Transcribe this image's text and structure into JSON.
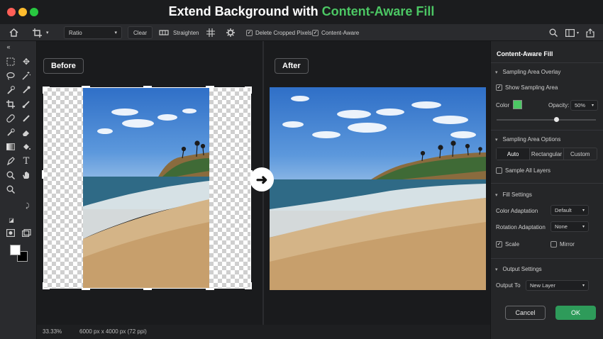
{
  "title": {
    "prefix": "Extend Background with",
    "accent": "Content-Aware Fill"
  },
  "options_bar": {
    "ratio_select": "Ratio",
    "clear_label": "Clear",
    "straighten_label": "Straighten",
    "delete_cropped_label": "Delete Cropped Pixels",
    "delete_cropped_checked": true,
    "content_aware_label": "Content-Aware",
    "content_aware_checked": true,
    "icons": [
      "home-icon",
      "crop-icon",
      "level-icon",
      "grid-overlay-icon",
      "settings-icon",
      "search-icon",
      "panels-icon",
      "share-icon"
    ]
  },
  "canvas": {
    "before_label": "Before",
    "after_label": "After"
  },
  "status": {
    "zoom": "33.33%",
    "doc_info": "6000 px x 4000 px (72 ppi)"
  },
  "panel": {
    "title": "Content-Aware Fill",
    "sampling_overlay": {
      "heading": "Sampling Area Overlay",
      "show_label": "Show Sampling Area",
      "show_checked": true,
      "color_label": "Color",
      "color_value": "#4cc764",
      "opacity_label": "Opacity:",
      "opacity_value": "50%",
      "opacity_fraction": 0.6
    },
    "sampling_options": {
      "heading": "Sampling Area Options",
      "modes": [
        "Auto",
        "Rectangular",
        "Custom"
      ],
      "selected": "Auto",
      "sample_all_label": "Sample All Layers",
      "sample_all_checked": false
    },
    "fill_settings": {
      "heading": "Fill Settings",
      "color_adaptation_label": "Color Adaptation",
      "color_adaptation_value": "Default",
      "rotation_adaptation_label": "Rotation Adaptation",
      "rotation_adaptation_value": "None",
      "scale_label": "Scale",
      "scale_checked": true,
      "mirror_label": "Mirror",
      "mirror_checked": false
    },
    "output_settings": {
      "heading": "Output Settings",
      "output_to_label": "Output To",
      "output_to_value": "New Layer"
    },
    "cancel_label": "Cancel",
    "ok_label": "OK"
  }
}
